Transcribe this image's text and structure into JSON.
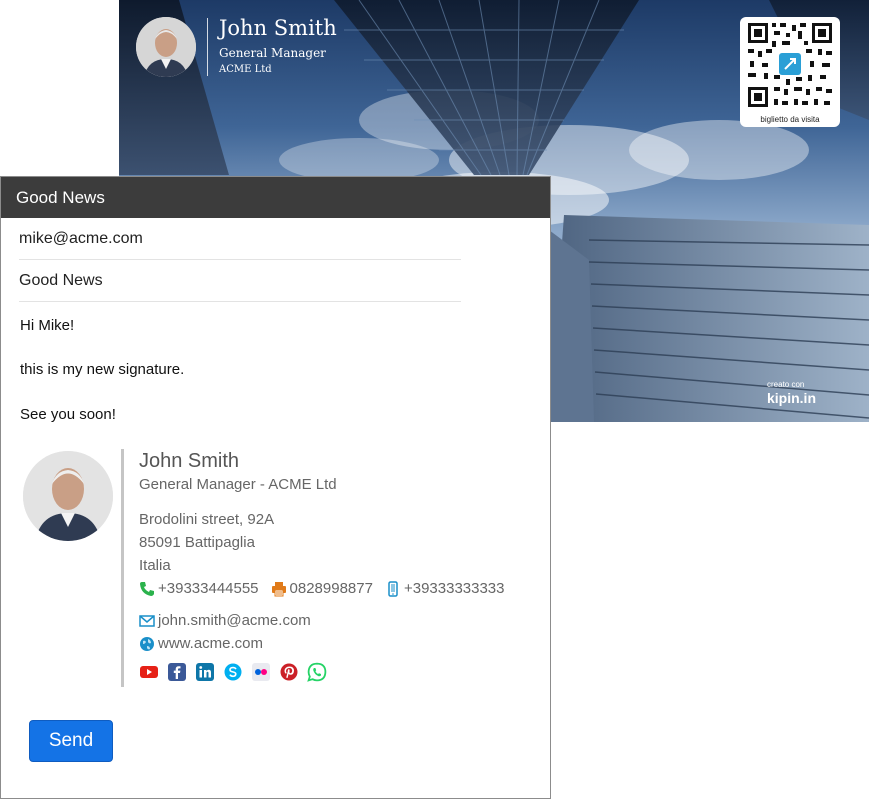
{
  "card": {
    "name": "John Smith",
    "title": "General Manager",
    "company": "ACME Ltd",
    "qr_caption": "biglietto da visita",
    "credit_small": "creato con",
    "credit_brand": "kipin.in"
  },
  "mail": {
    "header_title": "Good News",
    "to_value": "mike@acme.com",
    "subject_value": "Good News",
    "body": {
      "greeting": "Hi Mike!",
      "line1": "this is my new signature.",
      "closing": "See you soon!"
    },
    "send_label": "Send"
  },
  "signature": {
    "name": "John Smith",
    "role": "General Manager - ACME Ltd",
    "address1": "Brodolini street, 92A",
    "address2": "85091 Battipaglia",
    "country": "Italia",
    "phone": "+39333444555",
    "fax": "0828998877",
    "mobile": "+39333333333",
    "email": "john.smith@acme.com",
    "website": "www.acme.com",
    "social": [
      "youtube-icon",
      "facebook-icon",
      "linkedin-icon",
      "skype-icon",
      "flickr-icon",
      "pinterest-icon",
      "whatsapp-icon"
    ]
  },
  "colors": {
    "header_bg": "#3c3c3c",
    "send_button": "#1473e6",
    "phone_icon": "#2bb24c",
    "fax_icon": "#e07b1a",
    "mobile_icon": "#1a8fc9"
  }
}
